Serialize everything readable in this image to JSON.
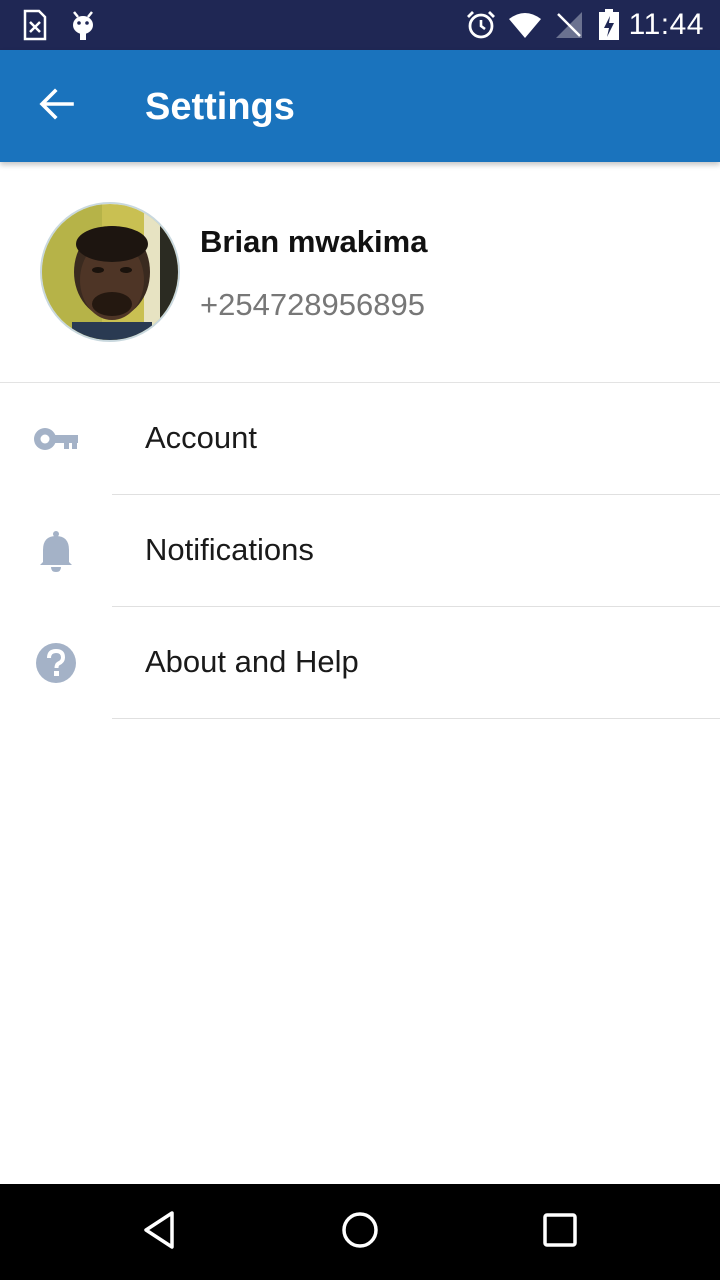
{
  "status_bar": {
    "time": "11:44",
    "icons": [
      "sim-card-error-icon",
      "android-debug-icon",
      "alarm-icon",
      "wifi-icon",
      "no-signal-icon",
      "battery-charging-icon"
    ]
  },
  "app_bar": {
    "title": "Settings",
    "back_icon": "arrow-back-icon",
    "color": "#1a73bd"
  },
  "profile": {
    "name": "Brian mwakima",
    "phone": "+254728956895"
  },
  "menu": {
    "items": [
      {
        "label": "Account",
        "icon": "key-icon"
      },
      {
        "label": "Notifications",
        "icon": "bell-icon"
      },
      {
        "label": "About and Help",
        "icon": "help-circle-icon"
      }
    ],
    "icon_color": "#a4b2c7"
  },
  "nav_bar": {
    "buttons": [
      "back-triangle-icon",
      "home-circle-icon",
      "recents-square-icon"
    ]
  }
}
